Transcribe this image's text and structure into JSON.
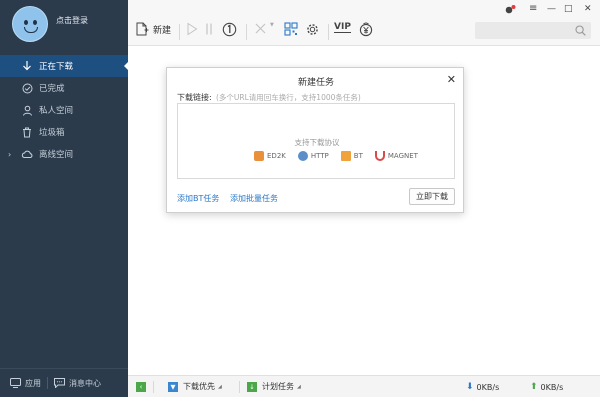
{
  "sidebar": {
    "login_text": "点击登录",
    "items": [
      {
        "label": "正在下载",
        "icon": "download-arrow-icon",
        "active": true
      },
      {
        "label": "已完成",
        "icon": "check-circle-icon",
        "active": false
      },
      {
        "label": "私人空间",
        "icon": "user-icon",
        "active": false
      },
      {
        "label": "垃圾箱",
        "icon": "trash-icon",
        "active": false
      },
      {
        "label": "离线空间",
        "icon": "cloud-icon",
        "active": false
      }
    ],
    "apps_label": "应用",
    "messages_label": "消息中心"
  },
  "toolbar": {
    "new_label": "新建",
    "vip_label": "VIP"
  },
  "window_controls": {
    "minimize": "—",
    "maximize": "□",
    "close": "✕"
  },
  "dialog": {
    "title": "新建任务",
    "close": "✕",
    "link_label": "下载链接:",
    "link_hint": "(多个URL请用回车换行，支持1000条任务)",
    "support_text": "支持下载协议",
    "protocols": [
      "ED2K",
      "HTTP",
      "BT",
      "MAGNET"
    ],
    "add_bt_label": "添加BT任务",
    "add_batch_label": "添加批量任务",
    "download_now_label": "立即下载"
  },
  "statusbar": {
    "priority_label": "下载优先",
    "schedule_label": "计划任务",
    "down_speed": "0KB/s",
    "up_speed": "0KB/s"
  },
  "colors": {
    "sidebar_bg": "#2c3b4b",
    "active_item_bg": "#1d4f80",
    "accent": "#2a78c8",
    "green": "#4aa84a"
  }
}
